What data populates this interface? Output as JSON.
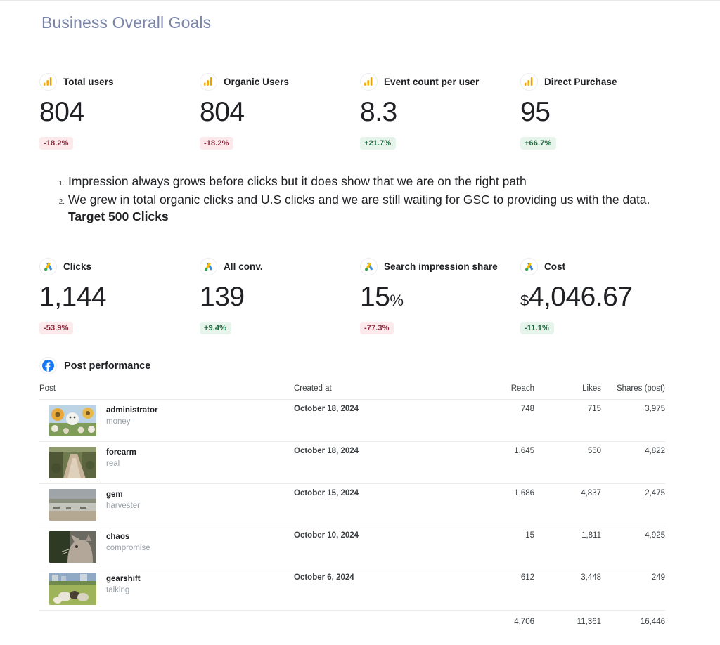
{
  "page": {
    "title": "Business Overall Goals"
  },
  "analytics_kpis": [
    {
      "icon": "google-analytics-icon",
      "label": "Total users",
      "value": "804",
      "delta": "-18.2%",
      "delta_dir": "neg"
    },
    {
      "icon": "google-analytics-icon",
      "label": "Organic Users",
      "value": "804",
      "delta": "-18.2%",
      "delta_dir": "neg"
    },
    {
      "icon": "google-analytics-icon",
      "label": "Event count per user",
      "value": "8.3",
      "delta": "+21.7%",
      "delta_dir": "pos"
    },
    {
      "icon": "google-analytics-icon",
      "label": "Direct Purchase",
      "value": "95",
      "delta": "+66.7%",
      "delta_dir": "pos"
    }
  ],
  "notes": [
    {
      "num": "1.",
      "text": "Impression always grows before clicks but it does show that we are on the right path",
      "bold": ""
    },
    {
      "num": "2.",
      "text": "We grew in total organic clicks and U.S clicks and we are still waiting for GSC to providing us with the data. ",
      "bold": "Target 500 Clicks"
    }
  ],
  "ads_kpis": [
    {
      "icon": "google-ads-icon",
      "label": "Clicks",
      "prefix": "",
      "value": "1,144",
      "suffix": "",
      "delta": "-53.9%",
      "delta_dir": "neg"
    },
    {
      "icon": "google-ads-icon",
      "label": "All conv.",
      "prefix": "",
      "value": "139",
      "suffix": "",
      "delta": "+9.4%",
      "delta_dir": "pos"
    },
    {
      "icon": "google-ads-icon",
      "label": "Search impression share",
      "prefix": "",
      "value": "15",
      "suffix": "%",
      "delta": "-77.3%",
      "delta_dir": "neg"
    },
    {
      "icon": "google-ads-icon",
      "label": "Cost",
      "prefix": "$",
      "value": "4,046.67",
      "suffix": "",
      "delta": "-11.1%",
      "delta_dir": "pos"
    }
  ],
  "post_performance": {
    "icon": "facebook-icon",
    "title": "Post performance",
    "columns": {
      "post": "Post",
      "created": "Created at",
      "reach": "Reach",
      "likes": "Likes",
      "shares": "Shares (post)"
    },
    "rows": [
      {
        "thumb": "sunflowers-cat-painting",
        "name": "administrator",
        "sub": "money",
        "created": "October 18, 2024",
        "reach": "748",
        "likes": "715",
        "shares": "3,975"
      },
      {
        "thumb": "forest-dirt-road",
        "name": "forearm",
        "sub": "real",
        "created": "October 18, 2024",
        "reach": "1,645",
        "likes": "550",
        "shares": "4,822"
      },
      {
        "thumb": "beach-shoreline",
        "name": "gem",
        "sub": "harvester",
        "created": "October 15, 2024",
        "reach": "1,686",
        "likes": "4,837",
        "shares": "2,475"
      },
      {
        "thumb": "cat-portrait",
        "name": "chaos",
        "sub": "compromise",
        "created": "October 10, 2024",
        "reach": "15",
        "likes": "1,811",
        "shares": "4,925"
      },
      {
        "thumb": "dogs-in-field",
        "name": "gearshift",
        "sub": "talking",
        "created": "October 6, 2024",
        "reach": "612",
        "likes": "3,448",
        "shares": "249"
      }
    ],
    "totals": {
      "reach": "4,706",
      "likes": "11,361",
      "shares": "16,446"
    }
  },
  "colors": {
    "title": "#7b86a8",
    "text": "#202124",
    "muted": "#9aa0a6",
    "positive_bg": "#e7f4ec",
    "positive_fg": "#1d6b3f",
    "negative_bg": "#fbe9ec",
    "negative_fg": "#8a2b3c",
    "analytics_orange": "#f9ab00",
    "ads_blue": "#3c8bd9",
    "facebook_blue": "#1877f2"
  }
}
